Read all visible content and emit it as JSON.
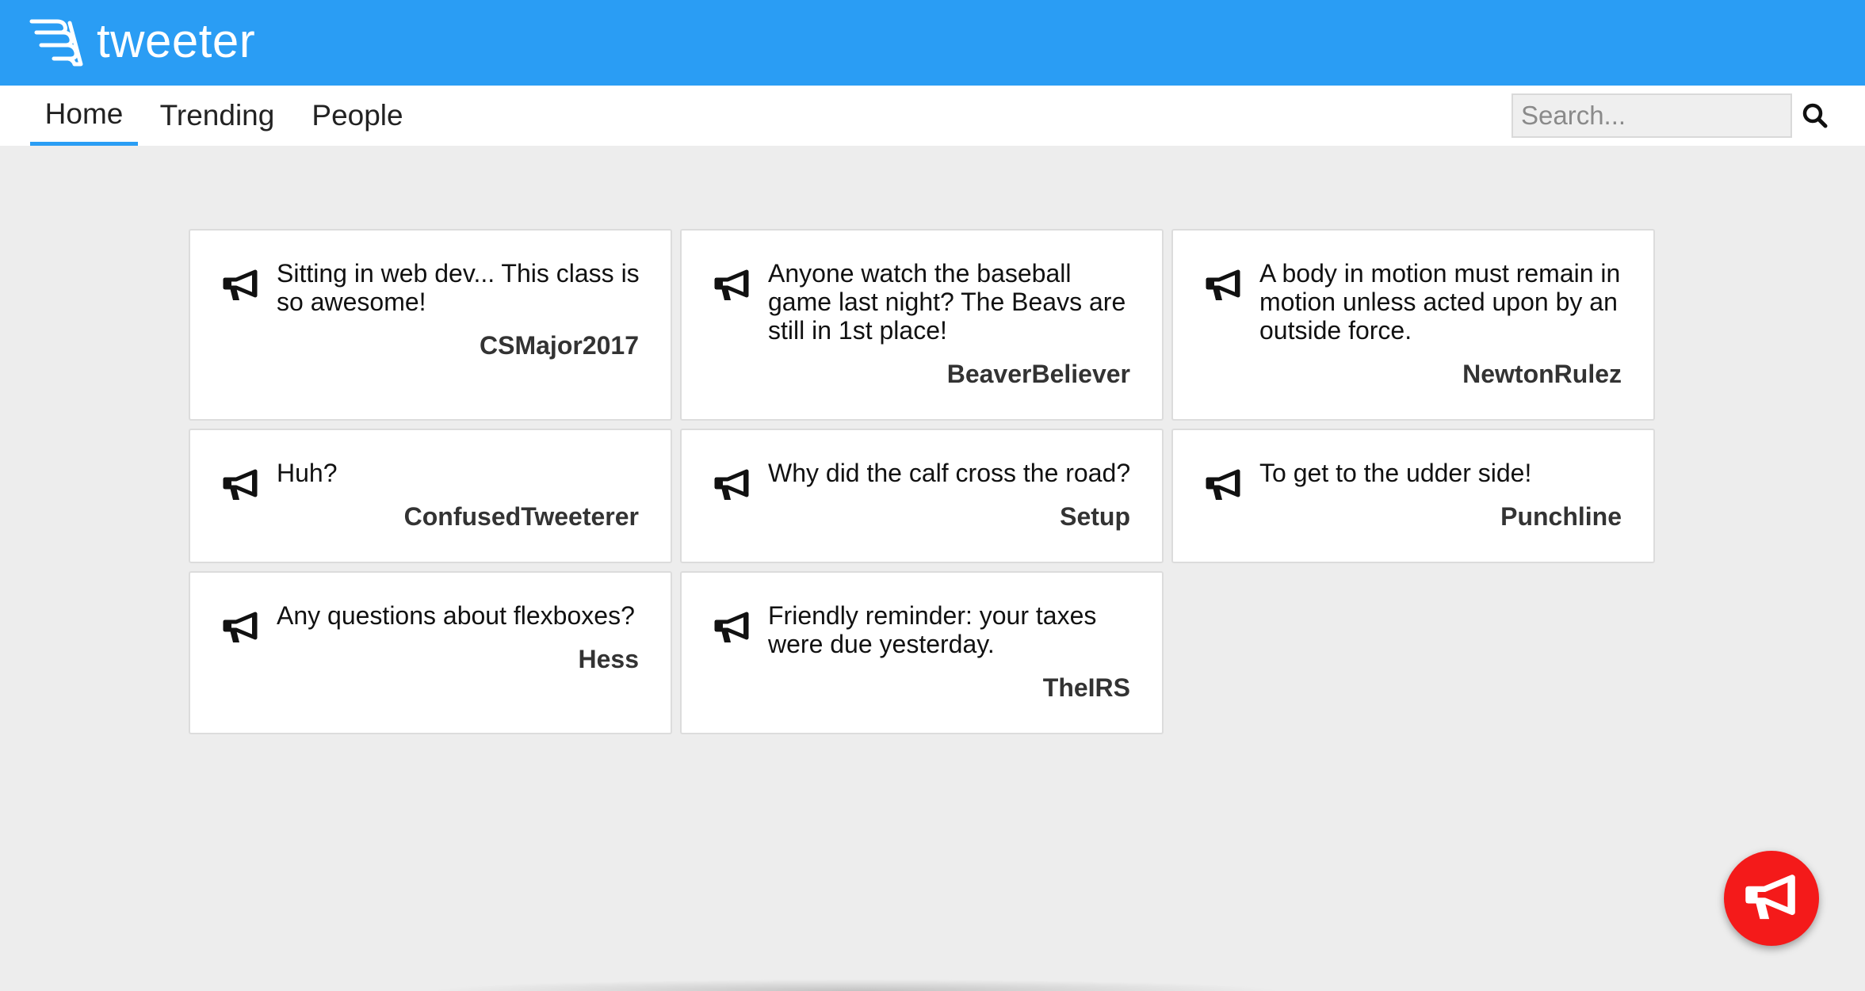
{
  "app": {
    "name": "tweeter",
    "accent_color": "#2a9df4",
    "logo_icon": "wing-icon"
  },
  "nav": {
    "tabs": [
      {
        "label": "Home",
        "active": true
      },
      {
        "label": "Trending",
        "active": false
      },
      {
        "label": "People",
        "active": false
      }
    ],
    "search": {
      "placeholder": "Search...",
      "value": "",
      "icon": "search-icon"
    }
  },
  "tweets": [
    {
      "text": "Sitting in web dev... This class is so awesome!",
      "author": "CSMajor2017"
    },
    {
      "text": "Anyone watch the baseball game last night? The Beavs are still in 1st place!",
      "author": "BeaverBeliever"
    },
    {
      "text": "A body in motion must remain in motion unless acted upon by an outside force.",
      "author": "NewtonRulez"
    },
    {
      "text": "Huh?",
      "author": "ConfusedTweeterer"
    },
    {
      "text": "Why did the calf cross the road?",
      "author": "Setup"
    },
    {
      "text": "To get to the udder side!",
      "author": "Punchline"
    },
    {
      "text": "Any questions about flexboxes?",
      "author": "Hess"
    },
    {
      "text": "Friendly reminder: your taxes were due yesterday.",
      "author": "TheIRS"
    }
  ],
  "fab": {
    "icon": "megaphone-icon",
    "color": "#f41a1a"
  }
}
